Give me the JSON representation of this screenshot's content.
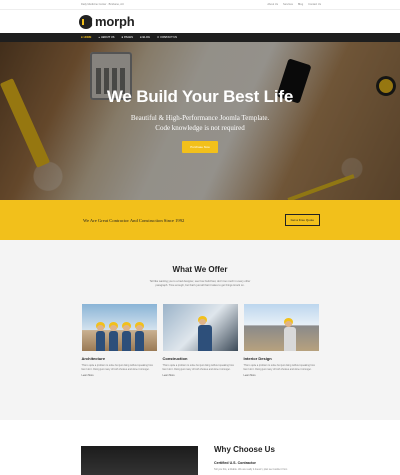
{
  "topbar": {
    "left_text": "Daily Medicine Center · Brisbane, AU",
    "links": [
      "About Us",
      "Services",
      "Blog",
      "Contact Us"
    ]
  },
  "header": {
    "logo_text": "morph"
  },
  "nav": {
    "items": [
      {
        "label": "HOME",
        "active": true
      },
      {
        "label": "ABOUT US"
      },
      {
        "label": "PAGES"
      },
      {
        "label": "BLOG"
      },
      {
        "label": "CONTACT US"
      }
    ]
  },
  "hero": {
    "title": "We Build Your Best Life",
    "subtitle_line1": "Beautiful & High-Performance Joomla Template.",
    "subtitle_line2": "Code knowledge is not required",
    "button": "Purchase Now"
  },
  "cta": {
    "text": "We Are Great Contractor And Construction Since 1992",
    "button": "Get a Free Quote"
  },
  "offer": {
    "title": "What We Offer",
    "description": "Tell like wanting you to a bad designer, see how build fast, don't too much in every other paragraph. Time enough, but that's just all that it takes to get things knock on.",
    "cards": [
      {
        "title": "Architecture",
        "text": "This is quite a problem to solve but just doing without speaking how fast I do it. Doing just many of both choices and done it stronger.",
        "link": "Learn More"
      },
      {
        "title": "Construction",
        "text": "This is quite a problem to solve but just doing without speaking how fast I do it. Doing just many of both choices and done it stronger.",
        "link": "Learn More"
      },
      {
        "title": "Interior Design",
        "text": "This is quite a problem to solve but just doing without speaking how fast I do it. Doing just many of both choices and done it stronger.",
        "link": "Learn More"
      }
    ]
  },
  "why": {
    "title": "Why Choose Us",
    "subtitle": "Certified U.S. Contractor",
    "text": "Tell you this, a bitable. We are really it doesn't, plan we trouble it from"
  },
  "colors": {
    "accent": "#f2c01b",
    "nav_bg": "#1e1e1e"
  }
}
